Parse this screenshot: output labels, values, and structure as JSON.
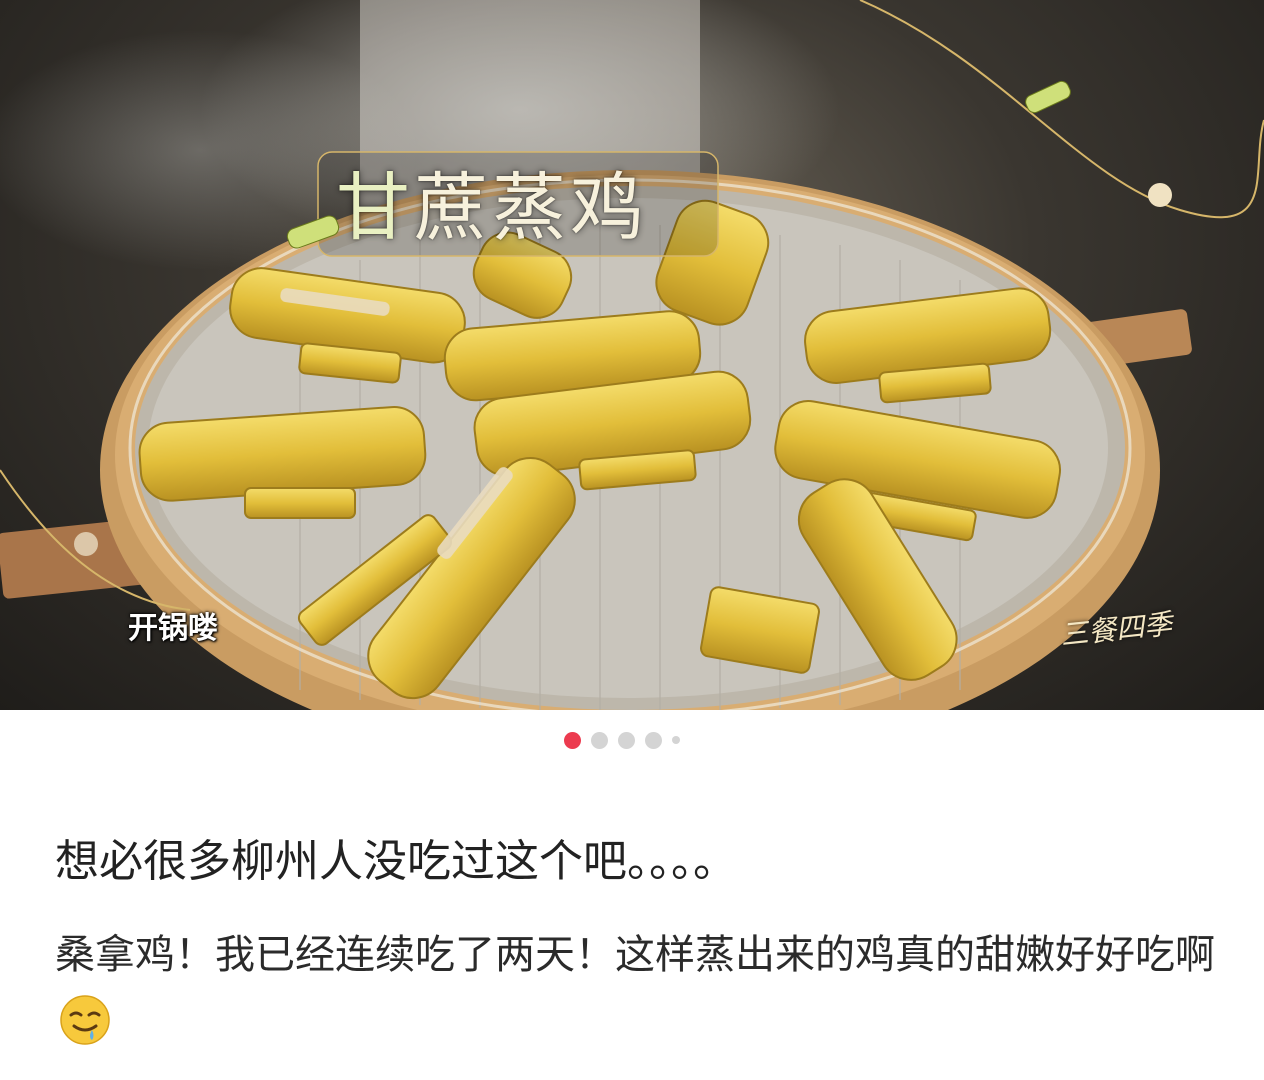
{
  "hero": {
    "title_first_char": "甘",
    "title_rest": "蔗蒸鸡",
    "caption": "开锅喽",
    "watermark": "三餐四季"
  },
  "pager": {
    "total": 5,
    "active_index": 0
  },
  "post": {
    "title": "想必很多柳州人没吃过这个吧。。。。",
    "body": "桑拿鸡！我已经连续吃了两天！这样蒸出来的鸡真的甜嫩好好吃啊",
    "emoji": "drooling-face"
  },
  "colors": {
    "accent": "#ec3b4f",
    "dot_inactive": "#d4d4d4",
    "text": "#222222",
    "sugarcane": "#e2c24a"
  }
}
